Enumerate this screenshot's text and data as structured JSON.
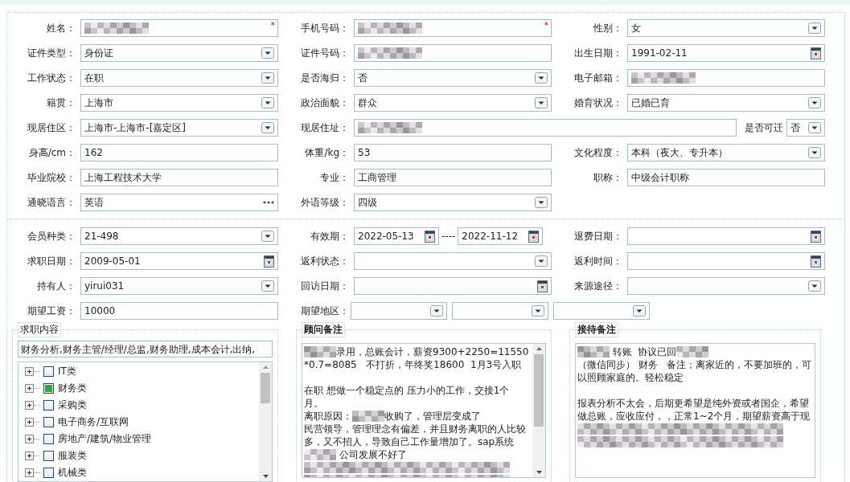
{
  "sections": [
    {
      "rows": [
        {
          "cells": [
            {
              "label": "姓名：",
              "field": {
                "kind": "text",
                "redacted": true,
                "required_mark": "*"
              }
            },
            {
              "label": "手机号码：",
              "field": {
                "kind": "text",
                "redacted": true,
                "required_mark": "*"
              }
            },
            {
              "label": "性别：",
              "field": {
                "kind": "select",
                "value": "女"
              }
            }
          ]
        },
        {
          "cells": [
            {
              "label": "证件类型：",
              "field": {
                "kind": "select",
                "value": "身份证"
              }
            },
            {
              "label": "证件号码：",
              "field": {
                "kind": "text",
                "redacted": true
              }
            },
            {
              "label": "出生日期：",
              "field": {
                "kind": "date",
                "value": "1991-02-11"
              }
            }
          ]
        },
        {
          "cells": [
            {
              "label": "工作状态：",
              "field": {
                "kind": "select",
                "value": "在职"
              }
            },
            {
              "label": "是否海归：",
              "field": {
                "kind": "select",
                "value": "否"
              }
            },
            {
              "label": "电子邮箱：",
              "field": {
                "kind": "text",
                "redacted": true
              }
            }
          ]
        },
        {
          "cells": [
            {
              "label": "籍贯：",
              "field": {
                "kind": "select",
                "value": "上海市"
              }
            },
            {
              "label": "政治面貌：",
              "field": {
                "kind": "select",
                "value": "群众"
              }
            },
            {
              "label": "婚育状况：",
              "field": {
                "kind": "select",
                "value": "已婚已育"
              }
            }
          ]
        },
        {
          "cells": [
            {
              "label": "现居住区：",
              "field": {
                "kind": "select",
                "value": "上海市-上海市-[嘉定区]"
              }
            },
            {
              "label": "现居住址：",
              "field": {
                "kind": "text",
                "redacted": true
              },
              "extra": {
                "label": "是否可迁",
                "field": {
                  "kind": "select",
                  "value": "否"
                }
              }
            }
          ]
        },
        {
          "cells": [
            {
              "label": "身高/cm：",
              "field": {
                "kind": "text",
                "value": "162"
              }
            },
            {
              "label": "体重/kg：",
              "field": {
                "kind": "text",
                "value": "53"
              }
            },
            {
              "label": "文化程度：",
              "field": {
                "kind": "select",
                "value": "本科（夜大、专升本）"
              }
            }
          ]
        },
        {
          "cells": [
            {
              "label": "毕业院校：",
              "field": {
                "kind": "text",
                "value": "上海工程技术大学"
              }
            },
            {
              "label": "专业：",
              "field": {
                "kind": "text",
                "value": "工商管理"
              }
            },
            {
              "label": "职称：",
              "field": {
                "kind": "text",
                "value": "中级会计职称"
              }
            }
          ]
        },
        {
          "cells": [
            {
              "label": "通晓语言：",
              "field": {
                "kind": "picker",
                "value": "英语"
              }
            },
            {
              "label": "外语等级：",
              "field": {
                "kind": "select",
                "value": "四级"
              }
            }
          ]
        }
      ]
    },
    {
      "rows": [
        {
          "cells": [
            {
              "label": "会员种类：",
              "field": {
                "kind": "select",
                "value": "21-498"
              }
            },
            {
              "label": "有效期：",
              "field": {
                "kind": "date_range",
                "from": "2022-05-13",
                "separator": "----",
                "to": "2022-11-12"
              }
            },
            {
              "label": "退费日期：",
              "field": {
                "kind": "date"
              }
            }
          ]
        },
        {
          "cells": [
            {
              "label": "求职日期：",
              "field": {
                "kind": "date",
                "value": "2009-05-01"
              }
            },
            {
              "label": "返利状态：",
              "field": {
                "kind": "select"
              }
            },
            {
              "label": "返利时间：",
              "field": {
                "kind": "date"
              }
            }
          ]
        },
        {
          "cells": [
            {
              "label": "持有人：",
              "field": {
                "kind": "select",
                "value": "yirui031"
              }
            },
            {
              "label": "回访日期：",
              "field": {
                "kind": "date"
              }
            },
            {
              "label": "来源途径：",
              "field": {
                "kind": "select"
              }
            }
          ]
        },
        {
          "cells": [
            {
              "label": "期望工资：",
              "field": {
                "kind": "text",
                "value": "10000"
              }
            },
            {
              "label": "期望地区：",
              "field": {
                "kind": "region_selects"
              }
            }
          ]
        }
      ]
    }
  ],
  "job_intent": {
    "title": "求职内容",
    "summary": "财务分析,财务主管/经理/总监,财务助理,成本会计,出纳,",
    "tree": [
      {
        "label": "IT类",
        "checked": false
      },
      {
        "label": "财务类",
        "checked": true
      },
      {
        "label": "采购类",
        "checked": false
      },
      {
        "label": "电子商务/互联网",
        "checked": false
      },
      {
        "label": "房地产/建筑/物业管理",
        "checked": false
      },
      {
        "label": "服装类",
        "checked": false
      },
      {
        "label": "机械类",
        "checked": false
      }
    ]
  },
  "consultant_notes": {
    "title": "顾问备注",
    "lines": [
      {
        "segments": [
          {
            "kind": "blur"
          },
          {
            "kind": "text",
            "text": "录用，总账会计，薪资9300+2250=11550"
          }
        ]
      },
      {
        "segments": [
          {
            "kind": "text",
            "text": "*0.7=8085   不打折，年终奖18600  1月3号入职"
          }
        ]
      },
      {
        "paragraph_start": true,
        "segments": [
          {
            "kind": "text",
            "text": "在职 想做一个稳定点的 压力小的工作，交接1个"
          }
        ]
      },
      {
        "segments": [
          {
            "kind": "text",
            "text": "月。"
          }
        ]
      },
      {
        "segments": [
          {
            "kind": "text",
            "text": "离职原因："
          },
          {
            "kind": "blur"
          },
          {
            "kind": "text",
            "text": "收购了，管理层变成了"
          }
        ]
      },
      {
        "segments": [
          {
            "kind": "text",
            "text": "民营领导，管理理念有偏差，并且财务离职的人比较"
          }
        ]
      },
      {
        "segments": [
          {
            "kind": "text",
            "text": "多，又不招人，导致自己工作量增加了。sap系统"
          }
        ]
      },
      {
        "segments": [
          {
            "kind": "blur"
          },
          {
            "kind": "text",
            "text": " 公司发展不好了"
          }
        ]
      },
      {
        "segments": [
          {
            "kind": "blur_line"
          }
        ]
      },
      {
        "segments": [
          {
            "kind": "blur_line"
          }
        ]
      }
    ]
  },
  "reception_notes": {
    "title": "接待备注",
    "lines": [
      {
        "segments": [
          {
            "kind": "blur"
          },
          {
            "kind": "text",
            "text": " 转账  协议已回"
          },
          {
            "kind": "blur"
          }
        ]
      },
      {
        "segments": [
          {
            "kind": "text",
            "text": "（微信同步） 财务   备注；离家近的，不要加班的，可"
          }
        ]
      },
      {
        "segments": [
          {
            "kind": "text",
            "text": "以照顾家庭的。轻松稳定"
          }
        ]
      },
      {
        "paragraph_start": true,
        "segments": [
          {
            "kind": "text",
            "text": "报表分析不太会，后期更希望是纯外资或者国企，希望"
          }
        ]
      },
      {
        "segments": [
          {
            "kind": "text",
            "text": "做总账，应收应付，，正常1~2个月，期望薪资高于现"
          }
        ]
      },
      {
        "segments": [
          {
            "kind": "blur_line"
          }
        ]
      },
      {
        "segments": [
          {
            "kind": "blur_line"
          }
        ]
      }
    ]
  }
}
